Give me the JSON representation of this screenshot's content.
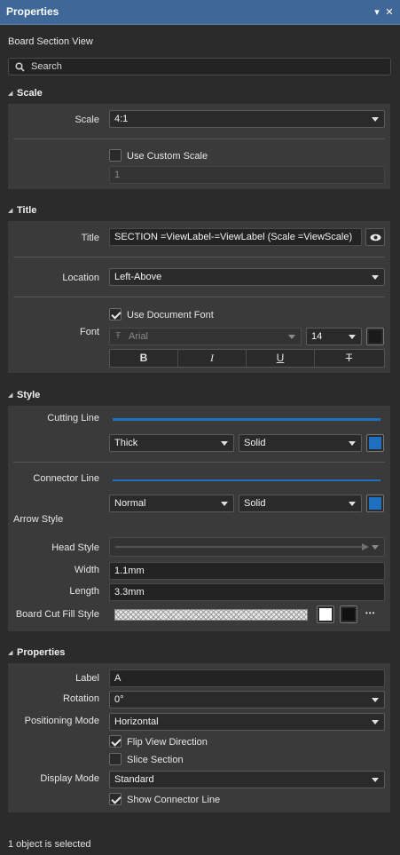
{
  "panel": {
    "title": "Properties",
    "menu_glyph": "▾",
    "close_glyph": "✕",
    "subtitle": "Board Section View"
  },
  "search": {
    "placeholder": "Search"
  },
  "scale": {
    "header": "Scale",
    "scale_label": "Scale",
    "scale_value": "4:1",
    "use_custom_label": "Use Custom Scale",
    "use_custom_checked": false,
    "custom_value": "1"
  },
  "title_section": {
    "header": "Title",
    "title_label": "Title",
    "title_value": "SECTION =ViewLabel-=ViewLabel (Scale =ViewScale)",
    "location_label": "Location",
    "location_value": "Left-Above",
    "font_label": "Font",
    "use_doc_font_label": "Use Document Font",
    "use_doc_font_checked": true,
    "font_name": "Arial",
    "font_size": "14",
    "bold_label": "B",
    "italic_label": "I",
    "underline_label": "U",
    "strike_label": "T"
  },
  "style": {
    "header": "Style",
    "cutting_line_label": "Cutting Line",
    "cutting_weight": "Thick",
    "cutting_style": "Solid",
    "connector_line_label": "Connector Line",
    "connector_weight": "Normal",
    "connector_style": "Solid",
    "arrow_style_header": "Arrow Style",
    "head_style_label": "Head Style",
    "width_label": "Width",
    "width_value": "1.1mm",
    "length_label": "Length",
    "length_value": "3.3mm",
    "fill_style_label": "Board Cut Fill Style",
    "more_glyph": "•••"
  },
  "properties": {
    "header": "Properties",
    "label_label": "Label",
    "label_value": "A",
    "rotation_label": "Rotation",
    "rotation_value": "0°",
    "positioning_label": "Positioning Mode",
    "positioning_value": "Horizontal",
    "flip_label": "Flip View Direction",
    "flip_checked": true,
    "slice_label": "Slice Section",
    "slice_checked": false,
    "display_mode_label": "Display Mode",
    "display_mode_value": "Standard",
    "show_connector_label": "Show Connector Line",
    "show_connector_checked": true
  },
  "status": {
    "text": "1 object is selected"
  },
  "colors": {
    "accent_blue": "#1e6fc0",
    "titlebar": "#3f6797",
    "panel_bg": "#3a3a3a",
    "bg": "#2b2b2b"
  }
}
